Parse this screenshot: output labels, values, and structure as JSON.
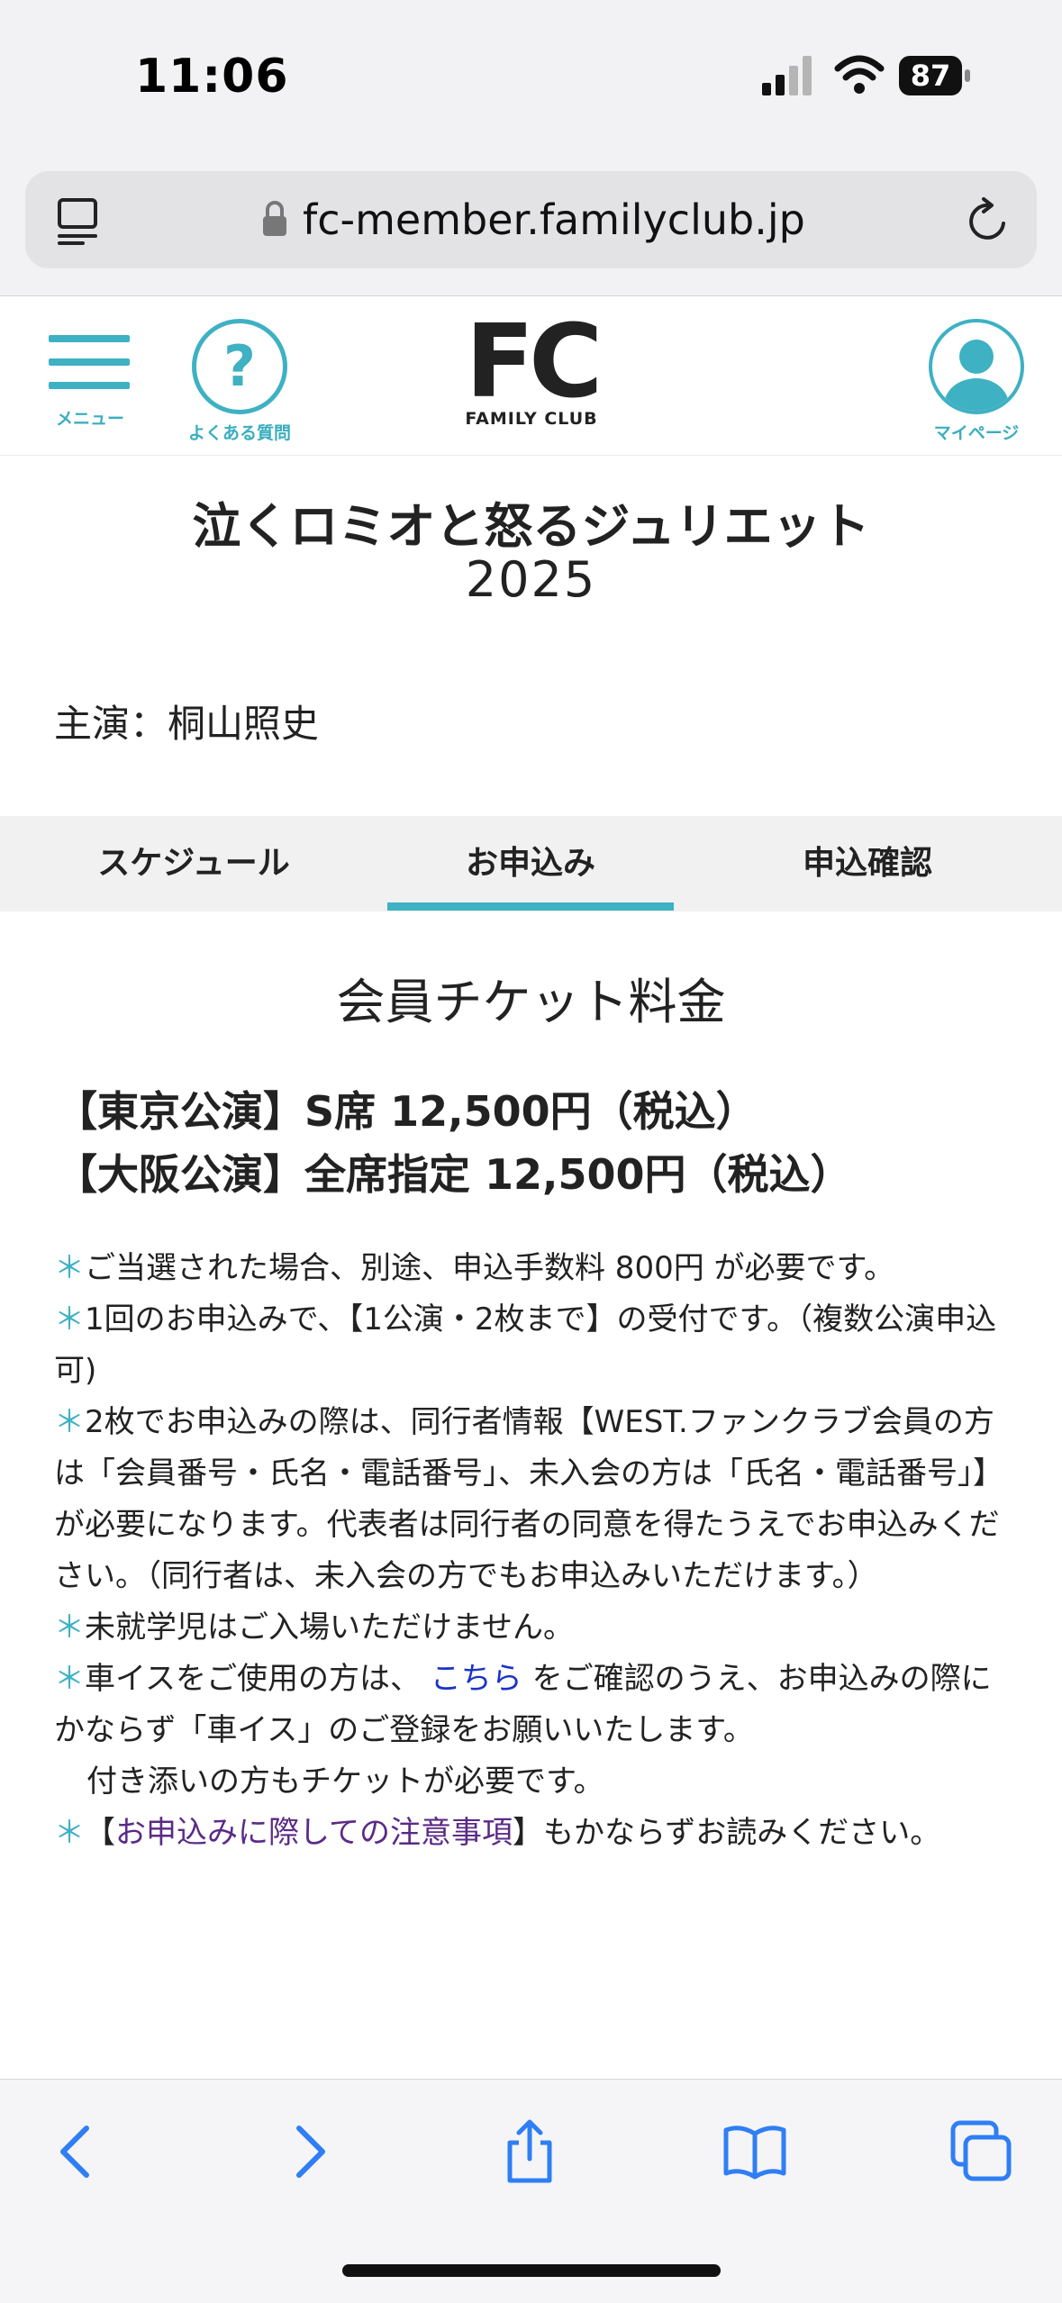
{
  "status_bar": {
    "time": "11:06",
    "battery": "87"
  },
  "browser": {
    "url": "fc-member.familyclub.jp"
  },
  "header": {
    "menu_label": "メニュー",
    "faq_label": "よくある質問",
    "logo_mark": "FC",
    "logo_sub": "FAMILY CLUB",
    "mypage_label": "マイページ"
  },
  "page": {
    "title": "泣くロミオと怒るジュリエット",
    "year": "2025",
    "cast": "主演：桐山照史"
  },
  "tabs": [
    {
      "label": "スケジュール",
      "active": false
    },
    {
      "label": "お申込み",
      "active": true
    },
    {
      "label": "申込確認",
      "active": false
    }
  ],
  "content": {
    "section_title": "会員チケット料金",
    "price_tokyo": "【東京公演】S席 12,500円（税込）",
    "price_osaka": "【大阪公演】全席指定 12,500円（税込）",
    "notes": {
      "asterisk": "＊",
      "n1": "ご当選された場合、別途、申込手数料 800円 が必要です。",
      "n2": "1回のお申込みで、【1公演・2枚まで】の受付です。（複数公演申込可)",
      "n3": "2枚でお申込みの際は、同行者情報【WEST.ファンクラブ会員の方は「会員番号・氏名・電話番号」、未入会の方は「氏名・電話番号」】が必要になります。代表者は同行者の同意を得たうえでお申込みください。（同行者は、未入会の方でもお申込みいただけます。）",
      "n4": "未就学児はご入場いただけません。",
      "n5_pre": "車イスをご使用の方は、",
      "n5_link": "こちら",
      "n5_post": "をご確認のうえ、お申込みの際にかならず「車イス」のご登録をお願いいたします。",
      "n5_extra": "付き添いの方もチケットが必要です。",
      "n6_open": "【",
      "n6_link": "お申込みに際しての注意事項",
      "n6_post": "】もかならずお読みください。"
    }
  },
  "colors": {
    "accent": "#3eb1c3",
    "link": "#1a33c8",
    "link_visited": "#5b2a86"
  },
  "toolbar_icons": [
    "back-icon",
    "forward-icon",
    "share-icon",
    "bookmarks-icon",
    "tabs-icon"
  ]
}
